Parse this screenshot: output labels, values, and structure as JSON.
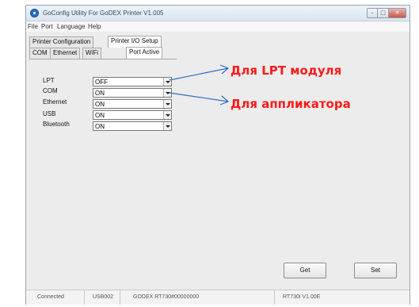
{
  "window": {
    "title": "GoConfig Utility For GoDEX Printer V1.005"
  },
  "menu": [
    "File",
    "Port",
    "Language",
    "Help"
  ],
  "top_tabs": [
    {
      "label": "Printer Configuration",
      "active": false
    },
    {
      "label": "Printer I/O Setup",
      "active": true
    }
  ],
  "sub_tabs": [
    {
      "label": "COM",
      "active": false
    },
    {
      "label": "Ethernet",
      "active": false
    },
    {
      "label": "WiFi",
      "active": false
    },
    {
      "label": "Port Active",
      "active": true
    }
  ],
  "ports": [
    {
      "label": "LPT",
      "value": "OFF"
    },
    {
      "label": "COM",
      "value": "ON"
    },
    {
      "label": "Ethernet",
      "value": "ON"
    },
    {
      "label": "USB",
      "value": "ON"
    },
    {
      "label": "Bluetooth",
      "value": "ON"
    }
  ],
  "buttons": {
    "get": "Get",
    "set": "Set"
  },
  "status": {
    "connection": "Connected",
    "port": "USB002",
    "device": "GODEX RT730#00000000",
    "firmware": "RT730i V1.00E"
  },
  "annotations": {
    "lpt_note": "Для LPT модуля",
    "applicator_note": "Для аппликатора",
    "color": "#ff1a1a"
  }
}
